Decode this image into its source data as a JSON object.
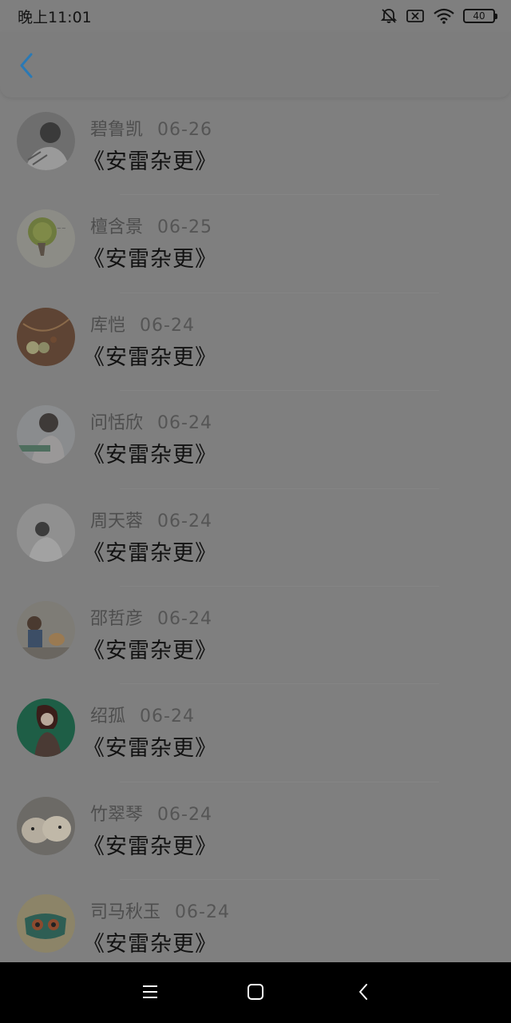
{
  "status_bar": {
    "time": "晚上11:01",
    "battery": "40"
  },
  "header": {
    "back_icon": "chevron-left-icon",
    "accent_color": "#2a79b5"
  },
  "items": [
    {
      "name": "碧鲁凯",
      "date": "06-26",
      "title": "《安雷杂更》"
    },
    {
      "name": "檀含景",
      "date": "06-25",
      "title": "《安雷杂更》"
    },
    {
      "name": "库恺",
      "date": "06-24",
      "title": "《安雷杂更》"
    },
    {
      "name": "问恬欣",
      "date": "06-24",
      "title": "《安雷杂更》"
    },
    {
      "name": "周天蓉",
      "date": "06-24",
      "title": "《安雷杂更》"
    },
    {
      "name": "邵哲彦",
      "date": "06-24",
      "title": "《安雷杂更》"
    },
    {
      "name": "绍孤",
      "date": "06-24",
      "title": "《安雷杂更》"
    },
    {
      "name": "竹翠琴",
      "date": "06-24",
      "title": "《安雷杂更》"
    },
    {
      "name": "司马秋玉",
      "date": "06-24",
      "title": "《安雷杂更》"
    }
  ],
  "nav_bar": {
    "menu_icon": "menu-icon",
    "home_icon": "home-square-icon",
    "back_icon": "back-chevron-icon"
  }
}
